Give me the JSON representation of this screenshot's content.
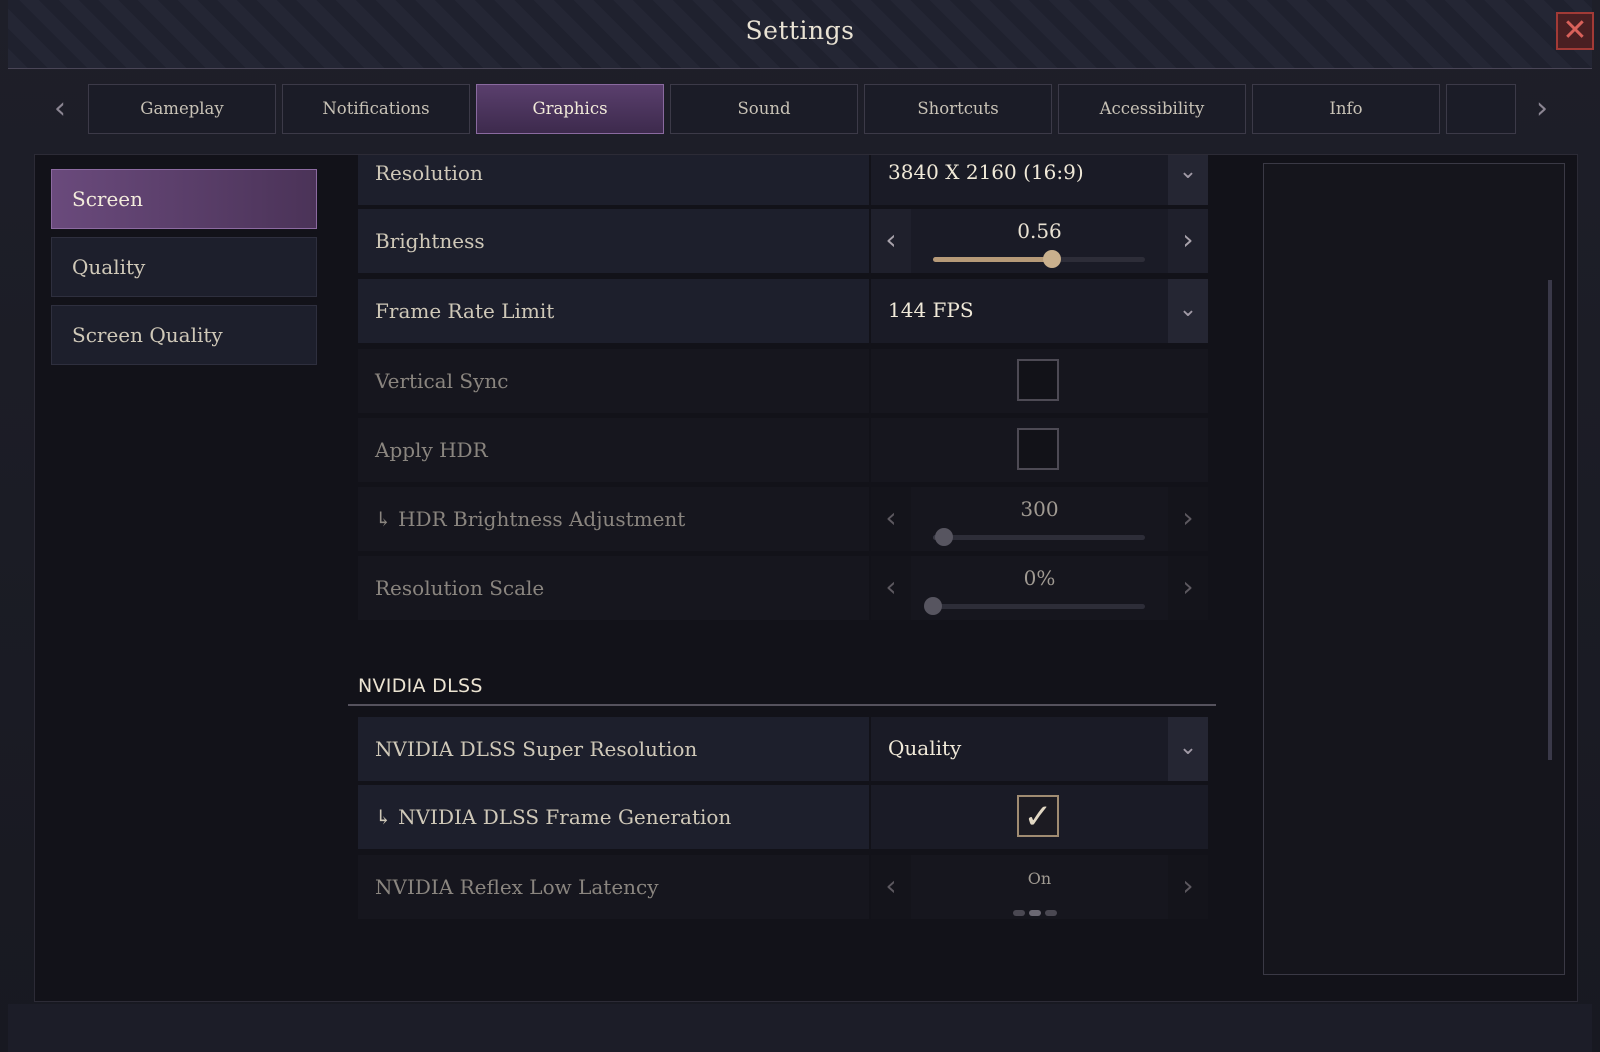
{
  "window": {
    "title": "Settings",
    "close_symbol": "✕"
  },
  "tabs": [
    {
      "label": "Gameplay",
      "active": false
    },
    {
      "label": "Notifications",
      "active": false
    },
    {
      "label": "Graphics",
      "active": true
    },
    {
      "label": "Sound",
      "active": false
    },
    {
      "label": "Shortcuts",
      "active": false
    },
    {
      "label": "Accessibility",
      "active": false
    },
    {
      "label": "Info",
      "active": false
    }
  ],
  "tab_arrows": {
    "left": "‹",
    "right": "›"
  },
  "sidebar": {
    "items": [
      {
        "label": "Screen",
        "active": true
      },
      {
        "label": "Quality",
        "active": false
      },
      {
        "label": "Screen Quality",
        "active": false
      }
    ]
  },
  "settings": {
    "resolution": {
      "label": "Resolution",
      "value": "3840 X 2160 (16:9)"
    },
    "brightness": {
      "label": "Brightness",
      "value": "0.56",
      "fraction": 0.56
    },
    "frame_rate_limit": {
      "label": "Frame Rate Limit",
      "value": "144 FPS"
    },
    "vertical_sync": {
      "label": "Vertical Sync",
      "checked": false
    },
    "apply_hdr": {
      "label": "Apply HDR",
      "checked": false
    },
    "hdr_brightness": {
      "label": "↳  HDR Brightness Adjustment",
      "value": "300",
      "fraction": 0.05
    },
    "resolution_scale": {
      "label": "Resolution Scale",
      "value": "0%",
      "fraction": 0.0
    }
  },
  "nvidia": {
    "section_title": "NVIDIA DLSS",
    "super_resolution": {
      "label": "NVIDIA DLSS Super Resolution",
      "value": "Quality"
    },
    "frame_generation": {
      "label": "↳ NVIDIA DLSS Frame Generation",
      "checked": true
    },
    "reflex": {
      "label": "NVIDIA Reflex Low Latency",
      "value": "On",
      "options_count": 3,
      "selected_index": 1
    }
  },
  "icons": {
    "chevron_down": "⌄",
    "arrow_left": "‹",
    "arrow_right": "›",
    "check": "✓"
  },
  "colors": {
    "accent_purple": "#5a3f6d",
    "slider_fill": "#b69a78",
    "close_red": "#a23a36"
  }
}
